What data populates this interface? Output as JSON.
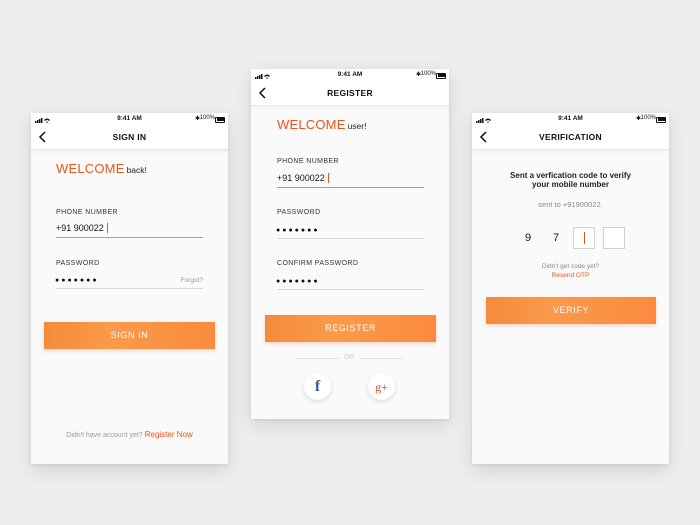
{
  "status": {
    "time": "9:41 AM",
    "battery": "100%"
  },
  "signin": {
    "title": "SIGN IN",
    "welcome": "WELCOME",
    "welcome_suffix": "back!",
    "phone_label": "PHONE NUMBER",
    "phone_value": "+91 900022",
    "password_label": "PASSWORD",
    "password_value": "●●●●●●●",
    "forgot": "Forgot?",
    "button": "SIGN IN",
    "footer_text": "Didn't have account yet?",
    "footer_link": "Register Now"
  },
  "register": {
    "title": "REGISTER",
    "welcome": "WELCOME",
    "welcome_suffix": "user!",
    "phone_label": "PHONE NUMBER",
    "phone_value": "+91 900022",
    "password_label": "PASSWORD",
    "password_value": "●●●●●●●",
    "confirm_label": "CONFIRM PASSWORD",
    "confirm_value": "●●●●●●●",
    "button": "REGISTER",
    "or": "OR",
    "facebook_glyph": "f",
    "google_glyph": "g+"
  },
  "verification": {
    "title": "VERIFICATION",
    "message_line1": "Sent a verfication code to verify",
    "message_line2": "your mobile number",
    "sent_to": "sent to +91900022.",
    "otp": [
      "9",
      "7",
      "",
      ""
    ],
    "question": "Didn't get code yet?",
    "resend": "Resend OTP",
    "button": "VERIFY"
  },
  "colors": {
    "accent": "#e8541e",
    "button": "#fa9a4a"
  }
}
